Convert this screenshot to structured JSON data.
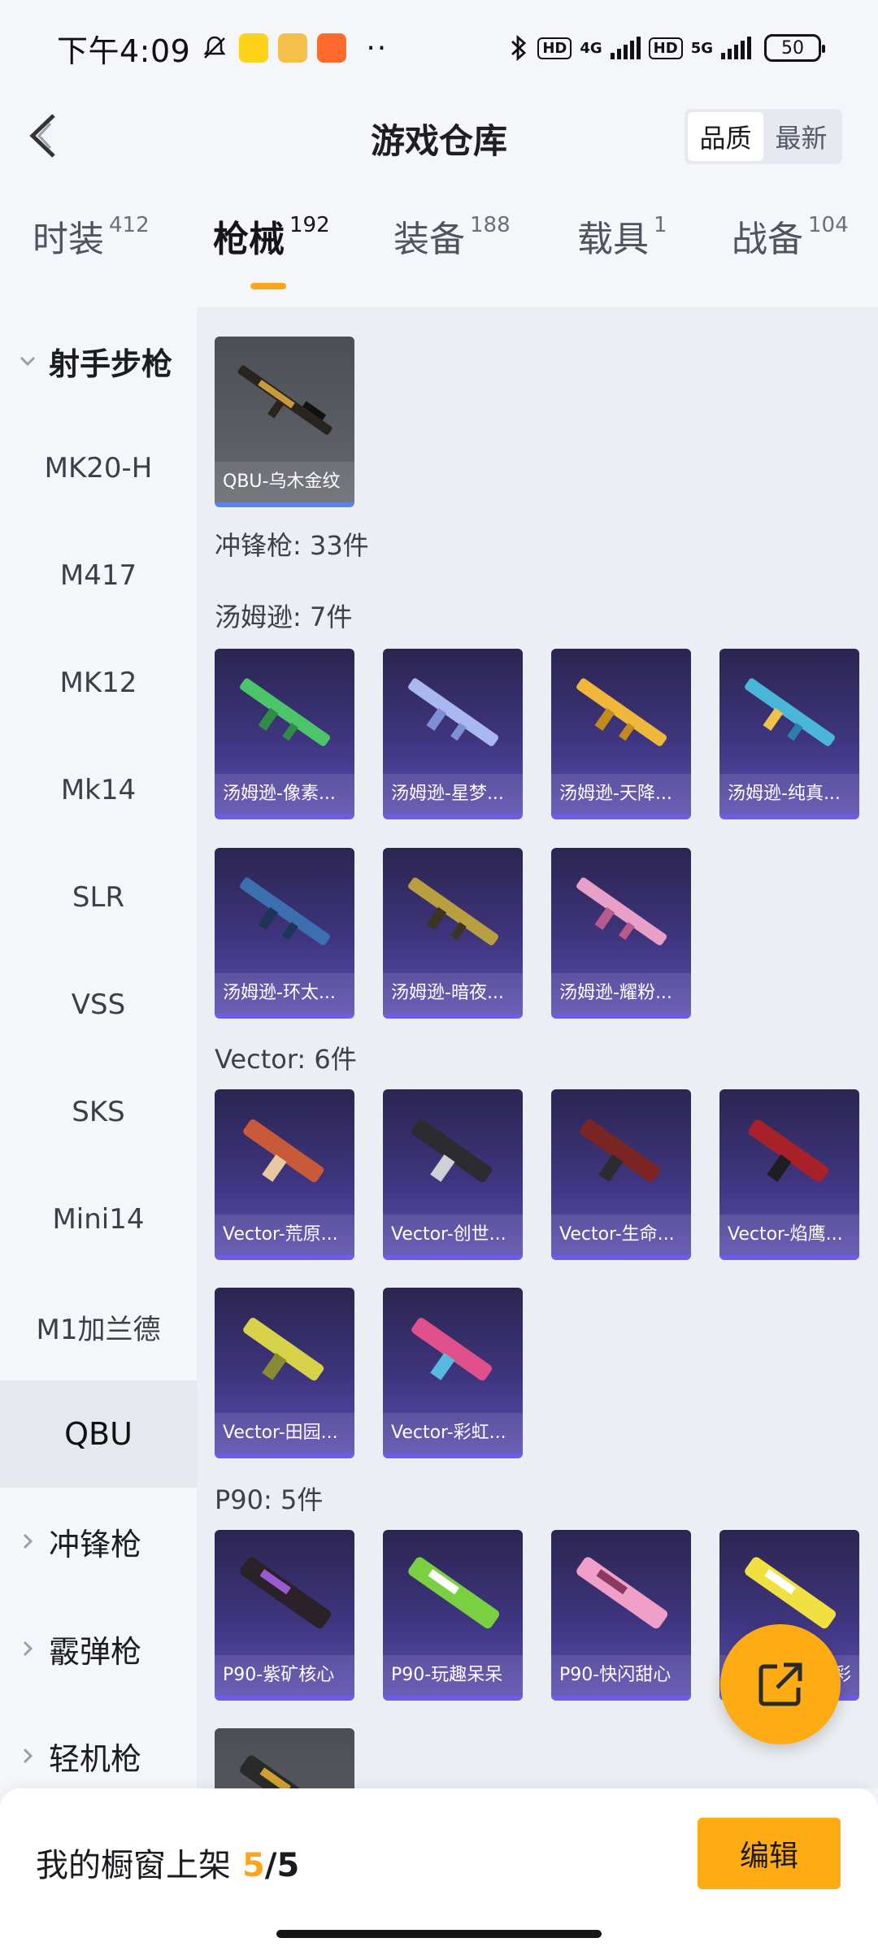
{
  "status_bar": {
    "time": "下午4:09",
    "network_1": "4G",
    "network_2": "5G",
    "hd_label": "HD",
    "battery": "50"
  },
  "header": {
    "title": "游戏仓库",
    "sort": {
      "quality": "品质",
      "latest": "最新"
    }
  },
  "tabs": [
    {
      "label": "时装",
      "count": "412"
    },
    {
      "label": "枪械",
      "count": "192"
    },
    {
      "label": "装备",
      "count": "188"
    },
    {
      "label": "载具",
      "count": "1"
    },
    {
      "label": "战备",
      "count": "104"
    }
  ],
  "sidebar": {
    "group_marksman": "射手步枪",
    "items": [
      "MK20-H",
      "M417",
      "MK12",
      "Mk14",
      "SLR",
      "VSS",
      "SKS",
      "Mini14",
      "M1加兰德",
      "QBU"
    ],
    "group_smg": "冲锋枪",
    "group_shotgun": "霰弹枪",
    "group_lmg": "轻机枪"
  },
  "content": {
    "qbu_card": "QBU-乌木金纹",
    "smg_title": "冲锋枪: 33件",
    "thompson_title": "汤姆逊: 7件",
    "thompson": [
      "汤姆逊-像素...",
      "汤姆逊-星梦...",
      "汤姆逊-天降...",
      "汤姆逊-纯真...",
      "汤姆逊-环太...",
      "汤姆逊-暗夜...",
      "汤姆逊-耀粉..."
    ],
    "vector_title": "Vector: 6件",
    "vector": [
      "Vector-荒原...",
      "Vector-创世...",
      "Vector-生命...",
      "Vector-焰鹰...",
      "Vector-田园...",
      "Vector-彩虹..."
    ],
    "p90_title": "P90: 5件",
    "p90": [
      "P90-紫矿核心",
      "P90-玩趣呆呆",
      "P90-快闪甜心",
      "彩"
    ]
  },
  "bottom": {
    "showcase_label": "我的橱窗上架",
    "showcase_count": "5",
    "showcase_total": "/5",
    "edit_label": "编辑"
  },
  "colors": {
    "accent": "#ffa318",
    "card_purple": "#3f357f",
    "card_grey": "#5b5d64"
  }
}
